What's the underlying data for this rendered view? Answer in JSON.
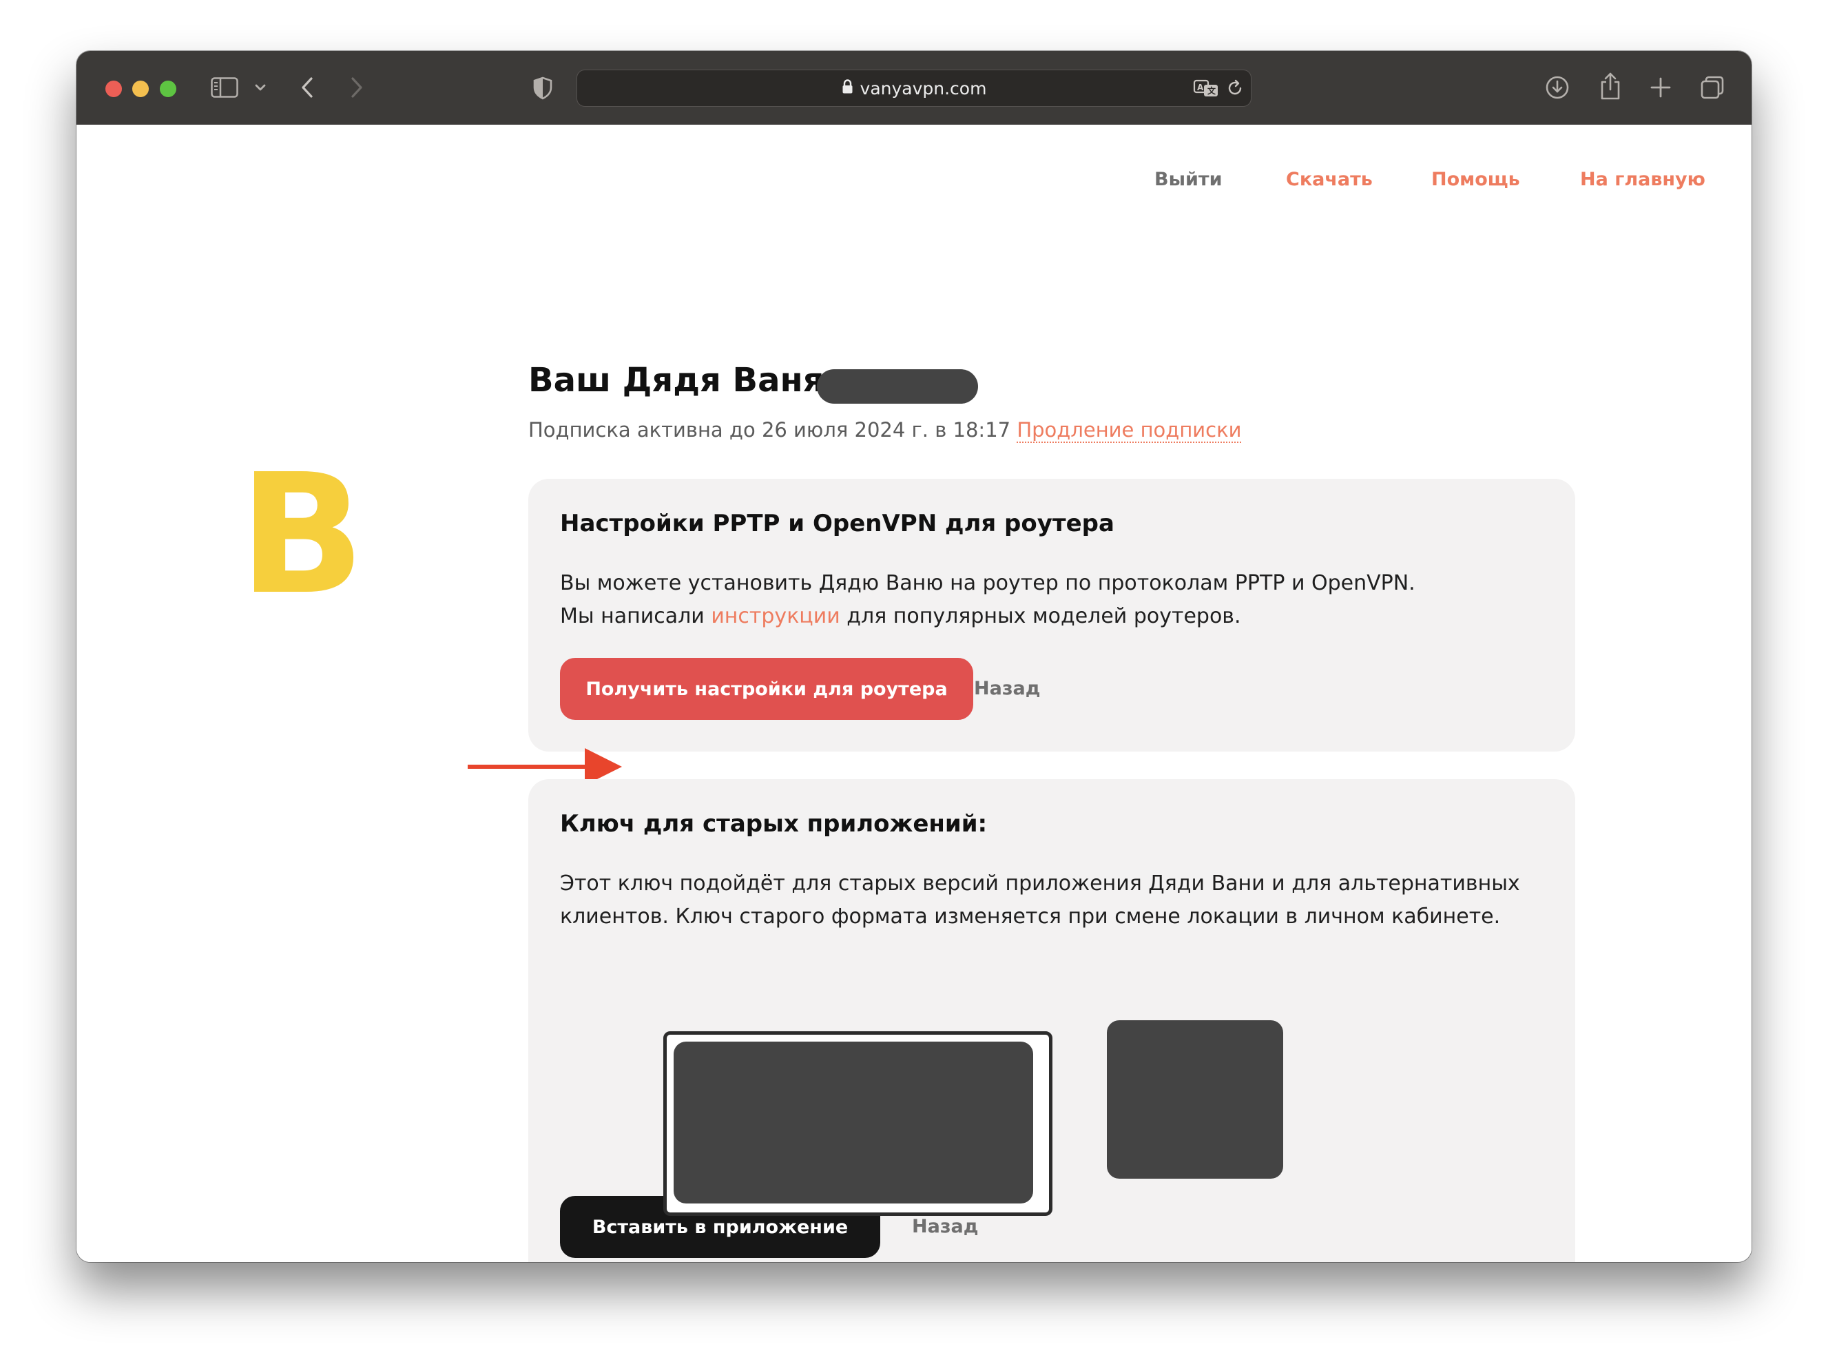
{
  "browser": {
    "url": "vanyavpn.com"
  },
  "nav": {
    "logout": "Выйти",
    "download": "Скачать",
    "help": "Помощь",
    "home": "На главную"
  },
  "logo": {
    "letter": "В",
    "color": "#f6cf3d"
  },
  "account": {
    "title": "Ваш Дядя Ваня",
    "subscription_status": "Подписка активна до 26 июля 2024 г. в 18:17",
    "renew_link": "Продление подписки"
  },
  "router_card": {
    "title": "Настройки PPTP и OpenVPN для роутера",
    "line1": "Вы можете установить Дядю Ваню на роутер по протоколам PPTP и OpenVPN.",
    "line2_before": "Мы написали ",
    "line2_link": "инструкции",
    "line2_after": " для популярных моделей роутеров.",
    "button": "Получить настройки для роутера",
    "back": "Назад"
  },
  "legacy_card": {
    "title": "Ключ для старых приложений:",
    "line1": "Этот ключ подойдёт для старых версий приложения Дяди Вани и для альтернативных",
    "line2": "клиентов. Ключ старого формата изменяется при смене локации в личном кабинете.",
    "button": "Вставить в приложение",
    "back": "Назад"
  },
  "colors": {
    "accent": "#ee7c5f",
    "primary_button": "#e0514f",
    "dark_button": "#161616",
    "card_bg": "#f3f2f2",
    "annotation_arrow": "#e8452c"
  }
}
